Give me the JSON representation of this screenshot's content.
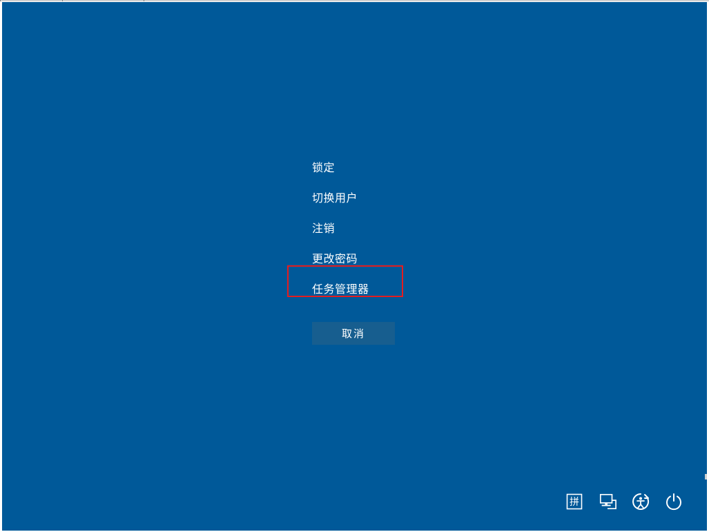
{
  "security_menu": {
    "items": [
      {
        "label": "锁定"
      },
      {
        "label": "切换用户"
      },
      {
        "label": "注销"
      },
      {
        "label": "更改密码"
      },
      {
        "label": "任务管理器"
      }
    ],
    "highlighted_index": 4,
    "cancel_label": "取消"
  },
  "tray": {
    "ime_label": "拼",
    "icons": [
      "ime",
      "network",
      "ease-of-access",
      "power"
    ]
  },
  "colors": {
    "background": "#005999",
    "highlight": "#e51d1f",
    "button_bg": "#175e8f",
    "text": "#ffffff"
  }
}
